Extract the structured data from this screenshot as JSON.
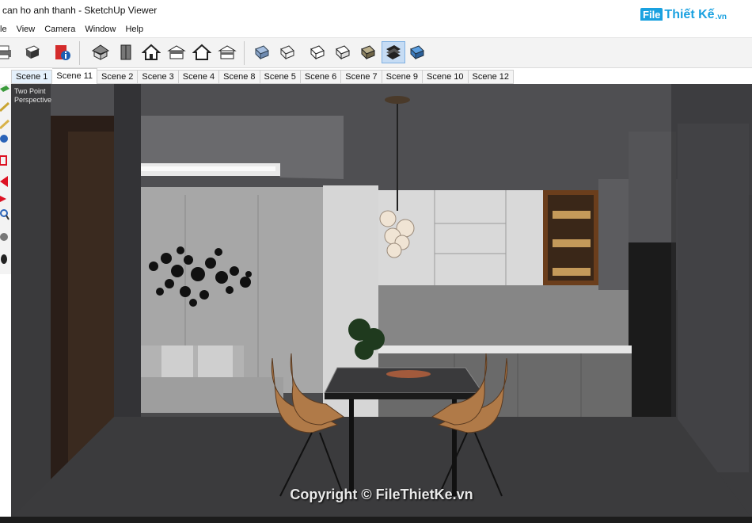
{
  "window": {
    "title": "can ho anh thanh - SketchUp Viewer"
  },
  "watermark": {
    "brand_mark": "File",
    "brand_text": "Thiết Kế",
    "brand_suffix": ".vn",
    "copyright": "Copyright © FileThietKe.vn"
  },
  "menu": {
    "items": [
      "le",
      "View",
      "Camera",
      "Window",
      "Help"
    ]
  },
  "toolbar": {
    "buttons": [
      {
        "name": "print-icon"
      },
      {
        "name": "print-preview-icon"
      },
      {
        "name": "model-info-icon"
      },
      {
        "name": "iso-view-icon"
      },
      {
        "name": "top-view-icon"
      },
      {
        "name": "front-view-icon"
      },
      {
        "name": "right-view-icon"
      },
      {
        "name": "back-view-icon"
      },
      {
        "name": "left-view-icon"
      },
      {
        "name": "xray-style-icon"
      },
      {
        "name": "wireframe-style-icon"
      },
      {
        "name": "hidden-line-style-icon"
      },
      {
        "name": "shaded-style-icon"
      },
      {
        "name": "shaded-textures-style-icon",
        "selected": true
      },
      {
        "name": "monochrome-style-icon"
      }
    ]
  },
  "scenes": {
    "tabs": [
      "Scene 1",
      "Scene 11",
      "Scene 2",
      "Scene 3",
      "Scene 4",
      "Scene 8",
      "Scene 5",
      "Scene 6",
      "Scene 7",
      "Scene 9",
      "Scene 10",
      "Scene 12"
    ],
    "active": "Scene 11"
  },
  "viewport": {
    "camera_line1": "Two Point",
    "camera_line2": "Perspective"
  },
  "colors": {
    "toolbar_bg": "#f3f3f3",
    "selected_button": "#c6dcf4",
    "brand": "#1aa1e0"
  }
}
